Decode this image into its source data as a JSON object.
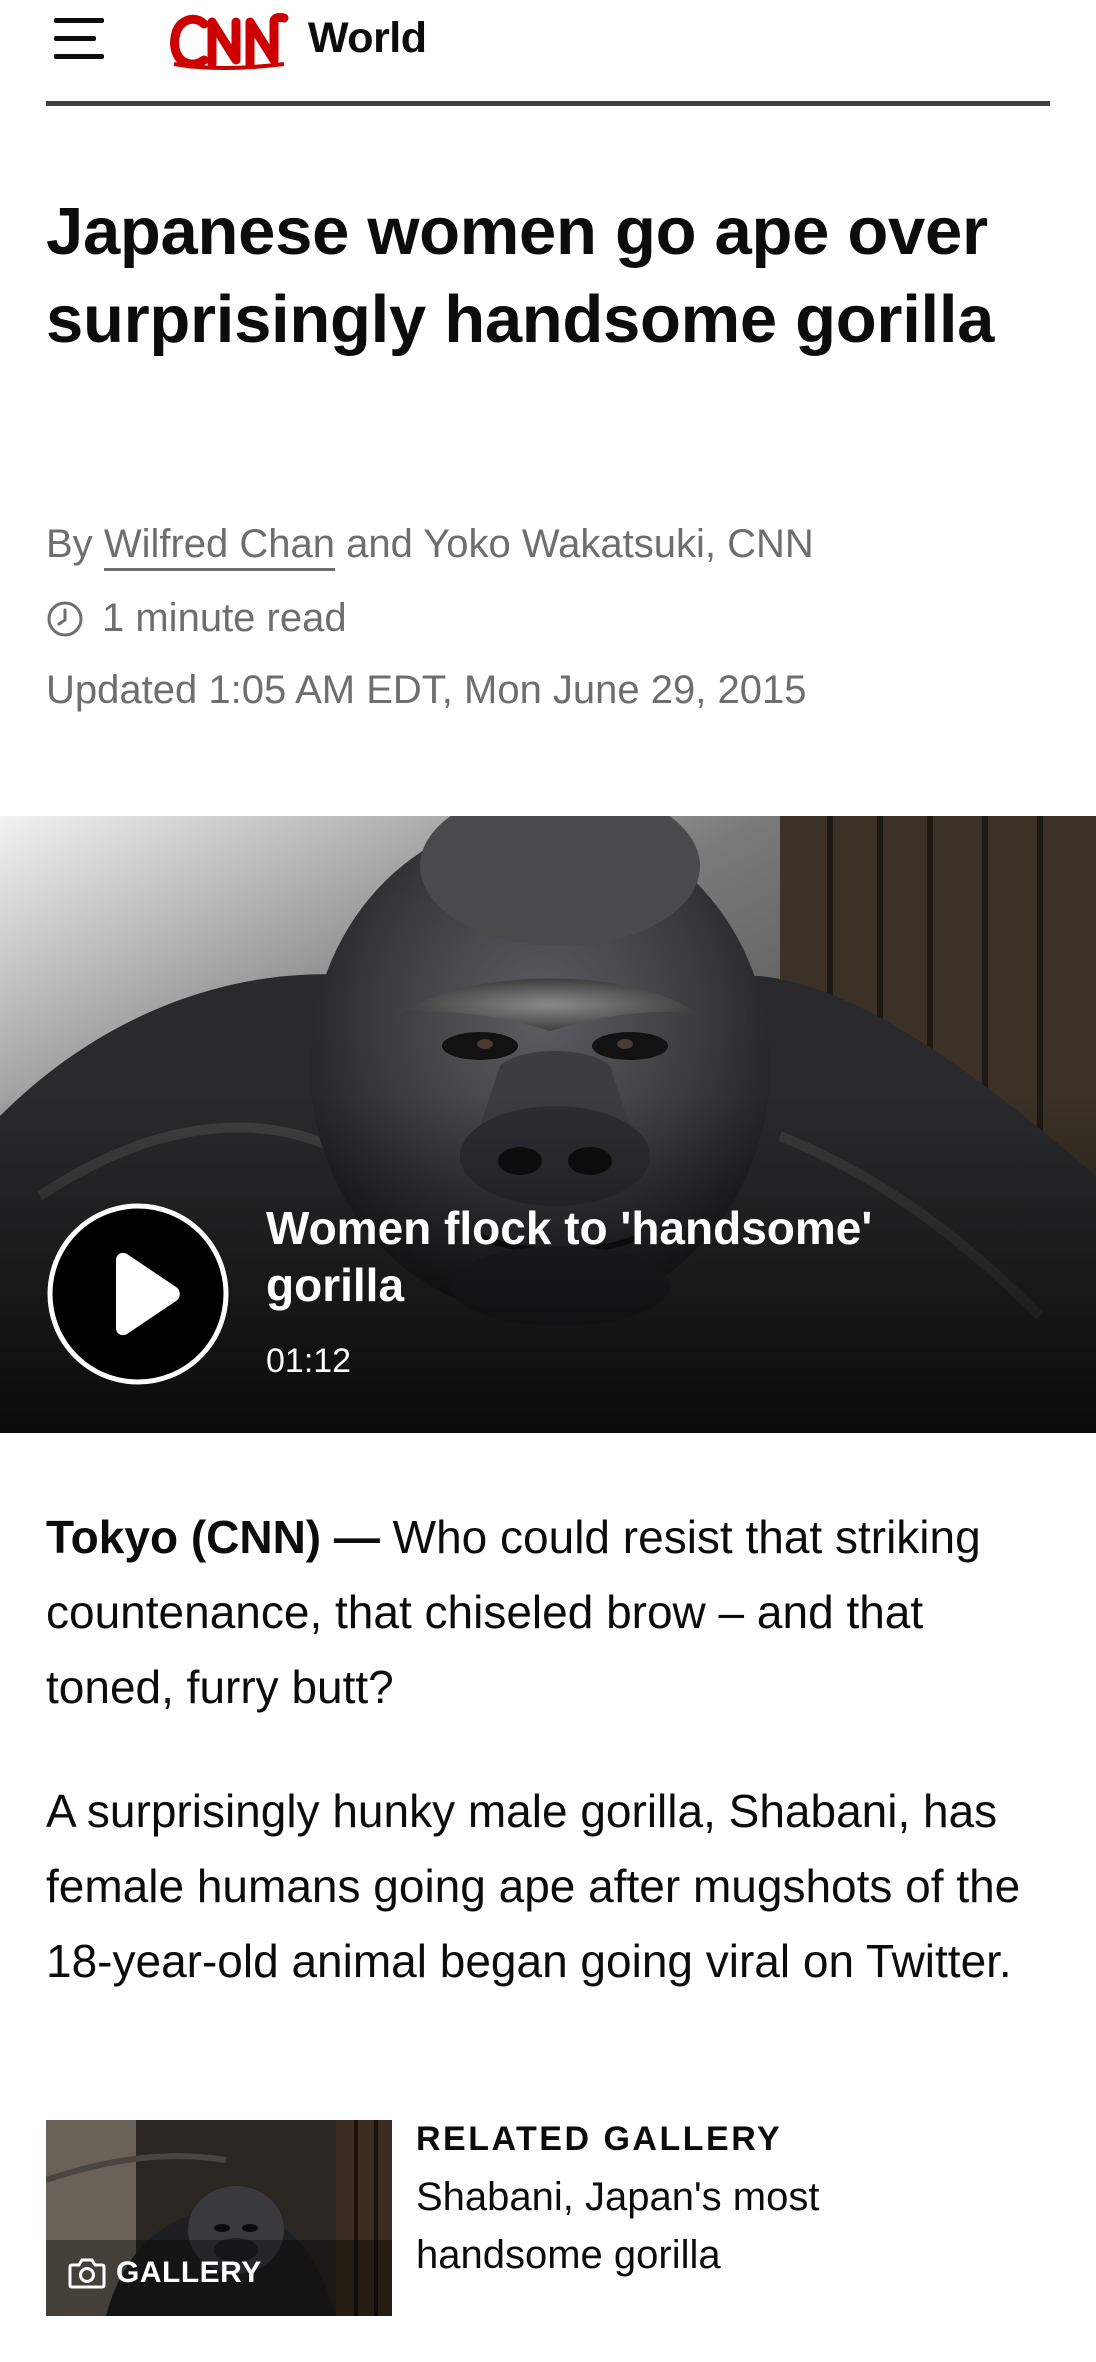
{
  "header": {
    "menu_icon": "hamburger-menu-icon",
    "logo_text": "CNN",
    "section": "World",
    "brand_color": "#cc0000"
  },
  "article": {
    "headline": "Japanese women go ape over surprisingly handsome gorilla",
    "byline": {
      "prefix": "By",
      "author_link": "Wilfred Chan",
      "rest": "and Yoko Wakatsuki, CNN"
    },
    "read_time_icon": "clock-icon",
    "read_time": "1 minute read",
    "updated": "Updated 1:05 AM EDT, Mon June 29, 2015"
  },
  "video": {
    "title": "Women flock to 'handsome' gorilla",
    "duration": "01:12",
    "play_icon": "play-icon"
  },
  "body": {
    "dateline": "Tokyo (CNN) —",
    "para1": " Who could resist that striking countenance, that chiseled brow – and that toned, furry butt?",
    "para2": "A surprisingly hunky male gorilla, Shabani, has female humans going ape after mugshots of the 18-year-old animal began going viral on Twitter."
  },
  "related": {
    "kicker": "RELATED GALLERY",
    "title": "Shabani, Japan's most handsome gorilla",
    "badge": "GALLERY",
    "badge_icon": "camera-icon"
  }
}
